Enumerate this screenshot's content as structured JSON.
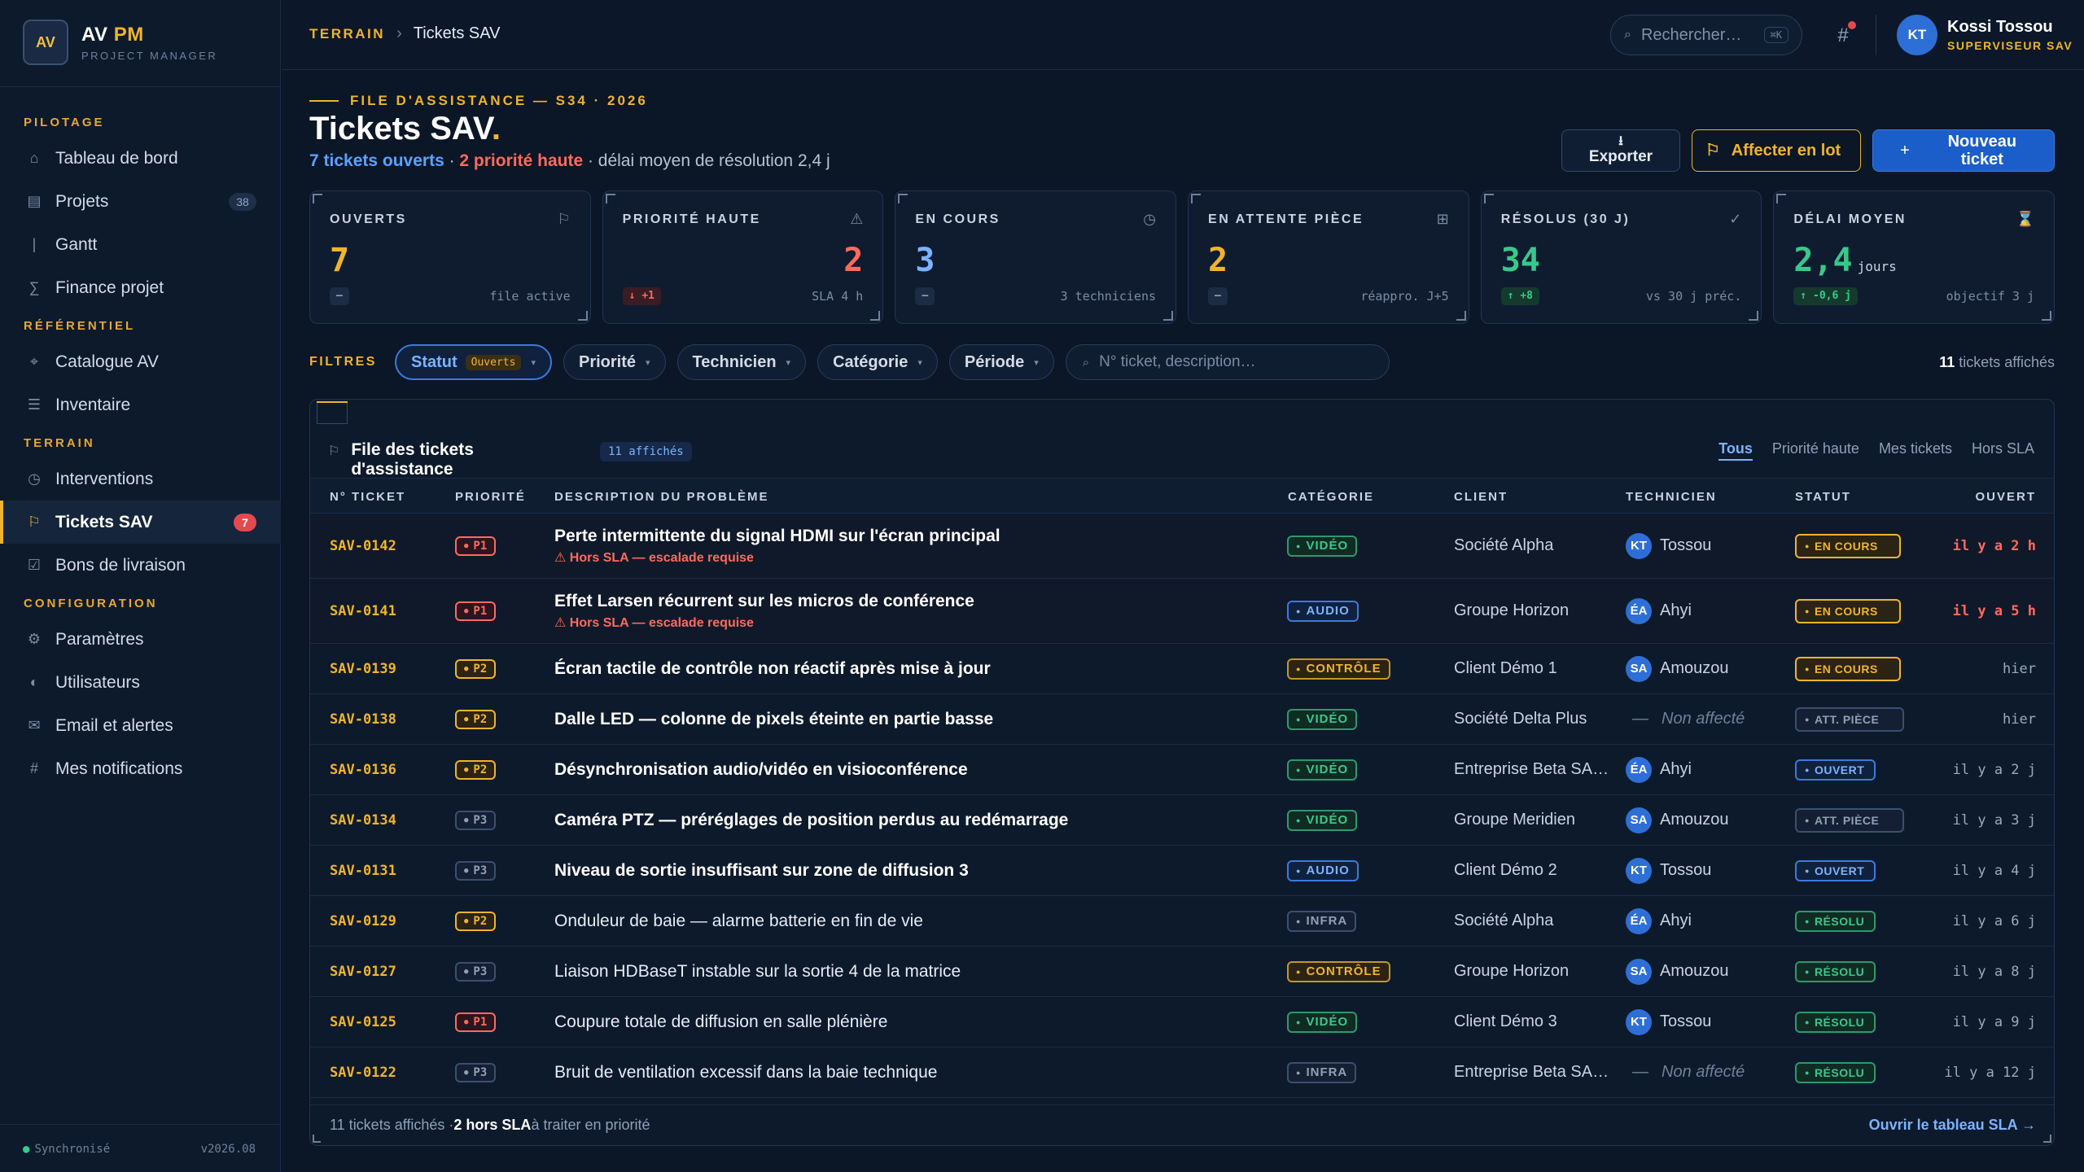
{
  "brand": {
    "logo": "AV",
    "name_a": "AV",
    "name_b": "PM",
    "subtitle": "PROJECT MANAGER"
  },
  "sidebar": {
    "sections": [
      {
        "title": "PILOTAGE",
        "items": [
          {
            "label": "Tableau de bord",
            "icon": "home-icon",
            "glyph": "⌂"
          },
          {
            "label": "Projets",
            "icon": "folder-icon",
            "glyph": "▤",
            "badge": "38"
          },
          {
            "label": "Gantt",
            "icon": "gantt-icon",
            "glyph": "|"
          },
          {
            "label": "Finance projet",
            "icon": "sum-icon",
            "glyph": "∑"
          }
        ]
      },
      {
        "title": "RÉFÉRENTIEL",
        "items": [
          {
            "label": "Catalogue AV",
            "icon": "catalog-icon",
            "glyph": "⌖"
          },
          {
            "label": "Inventaire",
            "icon": "list-icon",
            "glyph": "☰"
          }
        ]
      },
      {
        "title": "TERRAIN",
        "items": [
          {
            "label": "Interventions",
            "icon": "clock-icon",
            "glyph": "◷"
          },
          {
            "label": "Tickets SAV",
            "icon": "flag-icon",
            "glyph": "⚐",
            "badge": "7",
            "active": true
          },
          {
            "label": "Bons de livraison",
            "icon": "checkbox-icon",
            "glyph": "☑"
          }
        ]
      },
      {
        "title": "CONFIGURATION",
        "items": [
          {
            "label": "Paramètres",
            "icon": "gear-icon",
            "glyph": "⚙"
          },
          {
            "label": "Utilisateurs",
            "icon": "users-icon",
            "glyph": "◐"
          },
          {
            "label": "Email et alertes",
            "icon": "mail-icon",
            "glyph": "✉"
          },
          {
            "label": "Mes notifications",
            "icon": "hash-icon",
            "glyph": "#"
          }
        ]
      }
    ],
    "footer": {
      "status": "Synchronisé",
      "version": "v2026.08"
    }
  },
  "topbar": {
    "breadcrumb_root": "TERRAIN",
    "breadcrumb_sep": "›",
    "breadcrumb_current": "Tickets SAV",
    "search_placeholder": "Rechercher…",
    "search_kbd": "⌘K",
    "user": {
      "initials": "KT",
      "name": "Kossi Tossou",
      "role": "SUPERVISEUR SAV"
    }
  },
  "header": {
    "eyebrow": "FILE D'ASSISTANCE — S34 · 2026",
    "title": "Tickets SAV",
    "title_dot": ".",
    "open_count": "7 tickets ouverts",
    "sep1": " · ",
    "high_count": "2 priorité haute",
    "tail": " · délai moyen de résolution 2,4 j"
  },
  "actions": {
    "export": "Exporter",
    "assign": "Affecter en lot",
    "new": "Nouveau ticket"
  },
  "kpis": [
    {
      "label": "OUVERTS",
      "icon": "flag-icon",
      "glyph": "⚐",
      "value": "7",
      "color": "#f0b429",
      "delta": "–",
      "delta_type": "neutral",
      "note": "file active"
    },
    {
      "label": "PRIORITÉ HAUTE",
      "icon": "warning-icon",
      "glyph": "⚠",
      "value": "2",
      "color": "#ff6a5c",
      "delta": "↓ +1",
      "delta_type": "red",
      "note": "SLA 4 h",
      "align": "right"
    },
    {
      "label": "EN COURS",
      "icon": "clock-icon",
      "glyph": "◷",
      "value": "3",
      "color": "#7bb3ff",
      "delta": "–",
      "delta_type": "neutral",
      "note": "3 techniciens"
    },
    {
      "label": "EN ATTENTE PIÈCE",
      "icon": "box-icon",
      "glyph": "⊞",
      "value": "2",
      "color": "#f0b429",
      "delta": "–",
      "delta_type": "neutral",
      "note": "réappro. J+5"
    },
    {
      "label": "RÉSOLUS (30 J)",
      "icon": "check-icon",
      "glyph": "✓",
      "value": "34",
      "color": "#37c98b",
      "delta": "↑ +8",
      "delta_type": "green",
      "note": "vs 30 j préc."
    },
    {
      "label": "DÉLAI MOYEN",
      "icon": "hourglass-icon",
      "glyph": "⌛",
      "value": "2,4",
      "unit": "jours",
      "color": "#37c98b",
      "delta": "↑ -0,6 j",
      "delta_type": "green",
      "note": "objectif 3 j"
    }
  ],
  "filters": {
    "label": "FILTRES",
    "status": {
      "label": "Statut",
      "value": "Ouverts"
    },
    "chips": [
      "Priorité",
      "Technicien",
      "Catégorie",
      "Période"
    ],
    "search_placeholder": "N° ticket, description…",
    "count_num": "11",
    "count_text": " tickets affichés"
  },
  "table": {
    "title": "File des tickets d'assistance",
    "badge": "11 affichés",
    "tabs": [
      "Tous",
      "Priorité haute",
      "Mes tickets",
      "Hors SLA"
    ],
    "headers": [
      "N° TICKET",
      "PRIORITÉ",
      "DESCRIPTION DU PROBLÈME",
      "CATÉGORIE",
      "CLIENT",
      "TECHNICIEN",
      "STATUT",
      "OUVERT"
    ],
    "rows": [
      {
        "id": "SAV-0142",
        "prio": "P1",
        "desc": "Perte intermittente du signal HDMI sur l'écran principal",
        "warn": "⚠ Hors SLA — escalade requise",
        "cat": "VIDÉO",
        "cat_key": "video",
        "client": "Société Alpha",
        "tech_initials": "KT",
        "tech": "Tossou",
        "status": "EN COURS",
        "status_key": "encours",
        "opened": "il y a 2 h",
        "recent": true,
        "bold": true
      },
      {
        "id": "SAV-0141",
        "prio": "P1",
        "desc": "Effet Larsen récurrent sur les micros de conférence",
        "warn": "⚠ Hors SLA — escalade requise",
        "cat": "AUDIO",
        "cat_key": "audio",
        "client": "Groupe Horizon",
        "tech_initials": "ÉA",
        "tech": "Ahyi",
        "status": "EN COURS",
        "status_key": "encours",
        "opened": "il y a 5 h",
        "recent": true,
        "bold": true
      },
      {
        "id": "SAV-0139",
        "prio": "P2",
        "desc": "Écran tactile de contrôle non réactif après mise à jour",
        "cat": "CONTRÔLE",
        "cat_key": "controle",
        "client": "Client Démo 1",
        "tech_initials": "SA",
        "tech": "Amouzou",
        "status": "EN COURS",
        "status_key": "encours",
        "opened": "hier",
        "bold": true
      },
      {
        "id": "SAV-0138",
        "prio": "P2",
        "desc": "Dalle LED — colonne de pixels éteinte en partie basse",
        "cat": "VIDÉO",
        "cat_key": "video",
        "client": "Société Delta Plus",
        "tech_initials": "",
        "tech": "Non affecté",
        "status": "ATT. PIÈCE",
        "status_key": "attpiece",
        "opened": "hier",
        "bold": true
      },
      {
        "id": "SAV-0136",
        "prio": "P2",
        "desc": "Désynchronisation audio/vidéo en visioconférence",
        "cat": "VIDÉO",
        "cat_key": "video",
        "client": "Entreprise Beta SA…",
        "tech_initials": "ÉA",
        "tech": "Ahyi",
        "status": "OUVERT",
        "status_key": "ouvert",
        "opened": "il y a 2 j",
        "bold": true
      },
      {
        "id": "SAV-0134",
        "prio": "P3",
        "desc": "Caméra PTZ — préréglages de position perdus au redémarrage",
        "cat": "VIDÉO",
        "cat_key": "video",
        "client": "Groupe Meridien",
        "tech_initials": "SA",
        "tech": "Amouzou",
        "status": "ATT. PIÈCE",
        "status_key": "attpiece",
        "opened": "il y a 3 j",
        "bold": true
      },
      {
        "id": "SAV-0131",
        "prio": "P3",
        "desc": "Niveau de sortie insuffisant sur zone de diffusion 3",
        "cat": "AUDIO",
        "cat_key": "audio",
        "client": "Client Démo 2",
        "tech_initials": "KT",
        "tech": "Tossou",
        "status": "OUVERT",
        "status_key": "ouvert",
        "opened": "il y a 4 j",
        "bold": true
      },
      {
        "id": "SAV-0129",
        "prio": "P2",
        "desc": "Onduleur de baie — alarme batterie en fin de vie",
        "cat": "INFRA",
        "cat_key": "infra",
        "client": "Société Alpha",
        "tech_initials": "ÉA",
        "tech": "Ahyi",
        "status": "RÉSOLU",
        "status_key": "resolu",
        "opened": "il y a 6 j"
      },
      {
        "id": "SAV-0127",
        "prio": "P3",
        "desc": "Liaison HDBaseT instable sur la sortie 4 de la matrice",
        "cat": "CONTRÔLE",
        "cat_key": "controle",
        "client": "Groupe Horizon",
        "tech_initials": "SA",
        "tech": "Amouzou",
        "status": "RÉSOLU",
        "status_key": "resolu",
        "opened": "il y a 8 j"
      },
      {
        "id": "SAV-0125",
        "prio": "P1",
        "desc": "Coupure totale de diffusion en salle plénière",
        "cat": "VIDÉO",
        "cat_key": "video",
        "client": "Client Démo 3",
        "tech_initials": "KT",
        "tech": "Tossou",
        "status": "RÉSOLU",
        "status_key": "resolu",
        "opened": "il y a 9 j"
      },
      {
        "id": "SAV-0122",
        "prio": "P3",
        "desc": "Bruit de ventilation excessif dans la baie technique",
        "cat": "INFRA",
        "cat_key": "infra",
        "client": "Entreprise Beta SA…",
        "tech_initials": "",
        "tech": "Non affecté",
        "status": "RÉSOLU",
        "status_key": "resolu",
        "opened": "il y a 12 j"
      }
    ],
    "footer_a": "11 tickets affichés · ",
    "footer_b": "2 hors SLA",
    "footer_c": " à traiter en priorité",
    "footer_link": "Ouvrir le tableau SLA →"
  }
}
